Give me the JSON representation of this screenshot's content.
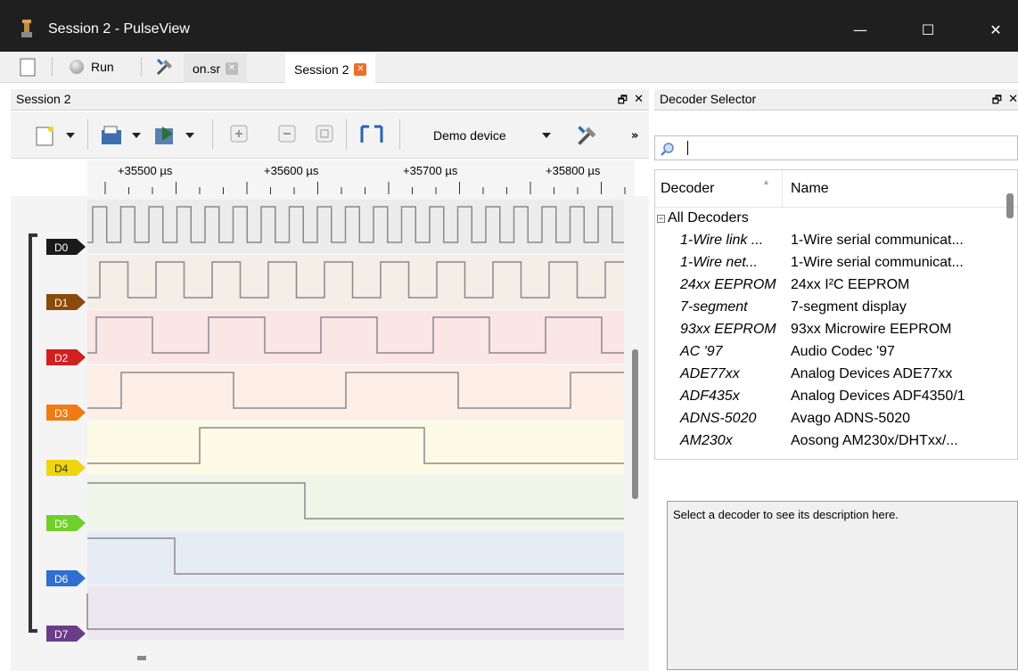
{
  "window": {
    "title": "Session 2 - PulseView",
    "minimize": "—",
    "maximize": "☐",
    "close": "✕"
  },
  "toolbar": {
    "run_label": "Run"
  },
  "tabs": [
    {
      "label": "on.sr"
    },
    {
      "label": "Session 2"
    }
  ],
  "session_panel": {
    "title": "Session 2",
    "float": "🗗",
    "close": "✕",
    "device": "Demo device",
    "more": "»"
  },
  "ruler": {
    "labels": [
      "+35500 µs",
      "+35600 µs",
      "+35700 µs",
      "+35800 µs"
    ]
  },
  "channels": [
    {
      "name": "D0",
      "color": "#1a1a1a",
      "bg": "#ececec"
    },
    {
      "name": "D1",
      "color": "#8b4a0a",
      "bg": "#f3eee6"
    },
    {
      "name": "D2",
      "color": "#d21f1f",
      "bg": "#fbe6e6"
    },
    {
      "name": "D3",
      "color": "#f07b12",
      "bg": "#fdeee6"
    },
    {
      "name": "D4",
      "color": "#efd40f",
      "bg": "#fdfbe6"
    },
    {
      "name": "D5",
      "color": "#6fd02a",
      "bg": "#eff6e8"
    },
    {
      "name": "D6",
      "color": "#2f6fd0",
      "bg": "#e6ecf6"
    },
    {
      "name": "D7",
      "color": "#6b3d89",
      "bg": "#ece6ef"
    }
  ],
  "decoder_panel": {
    "title": "Decoder Selector",
    "float": "🗗",
    "close": "✕",
    "search_value": "",
    "col_decoder": "Decoder",
    "col_name": "Name",
    "group": "All Decoders",
    "rows": [
      {
        "id": "1-Wire link ...",
        "name": "1-Wire serial communicat..."
      },
      {
        "id": "1-Wire net...",
        "name": "1-Wire serial communicat..."
      },
      {
        "id": "24xx EEPROM",
        "name": "24xx I²C EEPROM"
      },
      {
        "id": "7-segment",
        "name": "7-segment display"
      },
      {
        "id": "93xx EEPROM",
        "name": "93xx Microwire EEPROM"
      },
      {
        "id": "AC '97",
        "name": "Audio Codec '97"
      },
      {
        "id": "ADE77xx",
        "name": "Analog Devices ADE77xx"
      },
      {
        "id": "ADF435x",
        "name": "Analog Devices ADF4350/1"
      },
      {
        "id": "ADNS-5020",
        "name": "Avago ADNS-5020"
      },
      {
        "id": "AM230x",
        "name": "Aosong AM230x/DHTxx/..."
      }
    ],
    "description": "Select a decoder to see its description here."
  },
  "icons": {
    "app": "logic-probe-icon",
    "new": "new-session-icon",
    "open": "open-file-icon",
    "save": "save-icon",
    "zoom_in": "zoom-in-icon",
    "zoom_out": "zoom-out-icon",
    "zoom_fit": "zoom-fit-icon",
    "cursor": "cursor-icon",
    "config": "configure-icon",
    "search": "search-icon"
  }
}
